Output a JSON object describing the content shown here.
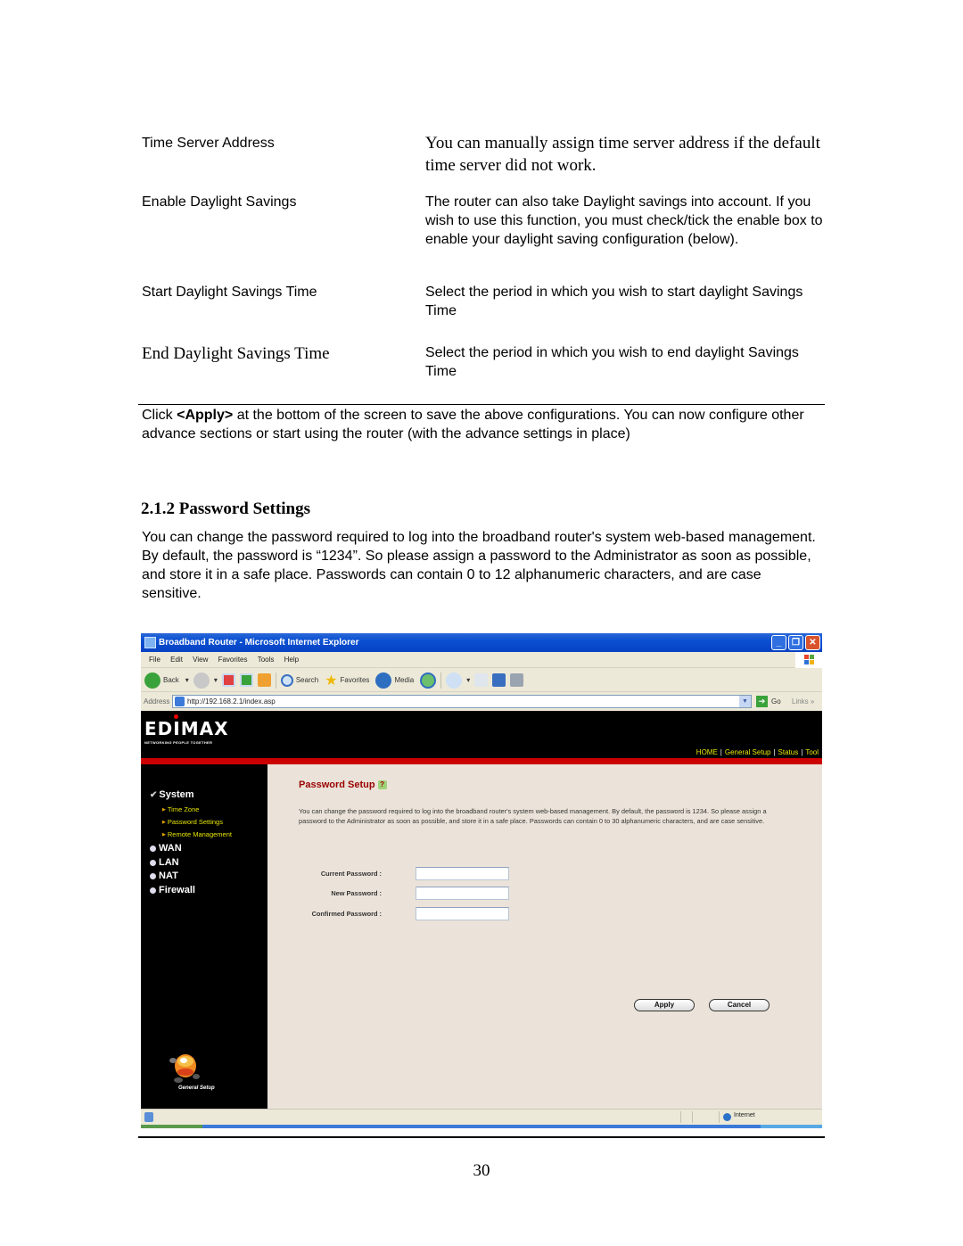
{
  "definitions": [
    {
      "term": "Time Server Address",
      "description": "You can manually assign time server address if the default time server did not work."
    },
    {
      "term": "Enable Daylight Savings",
      "description": "The router can also take Daylight savings into account. If you wish to use this function, you must check/tick the enable box to enable your daylight saving configuration (below)."
    },
    {
      "term": "Start Daylight Savings Time",
      "description": "Select the period in which you wish to start daylight Savings Time"
    },
    {
      "term": "End Daylight Savings Time",
      "description": "Select the period in which you wish to end daylight Savings Time"
    }
  ],
  "apply_note": {
    "prefix": "Click ",
    "button_ref": "<Apply>",
    "suffix": " at the bottom of the screen to save the above configurations. You can now configure other advance sections or start using the router (with the advance settings in place)"
  },
  "section": {
    "heading": "2.1.2 Password Settings",
    "body": "You can change the password required to log into the broadband router's system web-based management. By default, the password is “1234”. So please assign a password to the Administrator as soon as possible, and store it in a safe place. Passwords can contain 0 to 12 alphanumeric characters, and are case sensitive."
  },
  "browser": {
    "title": "Broadband Router - Microsoft Internet Explorer",
    "window_buttons": {
      "minimize": "_",
      "restore": "❐",
      "close": "✕"
    },
    "menu": [
      "File",
      "Edit",
      "View",
      "Favorites",
      "Tools",
      "Help"
    ],
    "toolbar": {
      "back": "Back",
      "search": "Search",
      "favorites": "Favorites",
      "media": "Media"
    },
    "address_label": "Address",
    "address_value": "http://192.168.2.1/index.asp",
    "go_label": "Go",
    "links_label": "Links »",
    "status_zone": "Internet"
  },
  "router_ui": {
    "logo": "EDIMAX",
    "tagline": "NETWORKING PEOPLE TOGETHER",
    "nav": [
      "HOME",
      "General Setup",
      "Status",
      "Tool"
    ],
    "sidebar": {
      "sections": [
        {
          "label": "System",
          "expanded": true,
          "children": [
            "Time Zone",
            "Password Settings",
            "Remote Management"
          ]
        },
        {
          "label": "WAN"
        },
        {
          "label": "LAN"
        },
        {
          "label": "NAT"
        },
        {
          "label": "Firewall"
        }
      ],
      "mascot_label": "General Setup"
    },
    "content": {
      "title": "Password Setup",
      "help_icon": "?",
      "description": "You can change the password required to log into the broadband router's system web-based management. By default, the password is 1234. So please assign a password to the Administrator as soon as possible, and store it in a safe place. Passwords can contain 0 to 30 alphanumeric characters, and are case sensitive.",
      "fields": [
        {
          "label": "Current Password :",
          "value": ""
        },
        {
          "label": "New Password :",
          "value": ""
        },
        {
          "label": "Confirmed Password :",
          "value": ""
        }
      ],
      "apply_label": "Apply",
      "cancel_label": "Cancel"
    }
  },
  "page_number": "30"
}
